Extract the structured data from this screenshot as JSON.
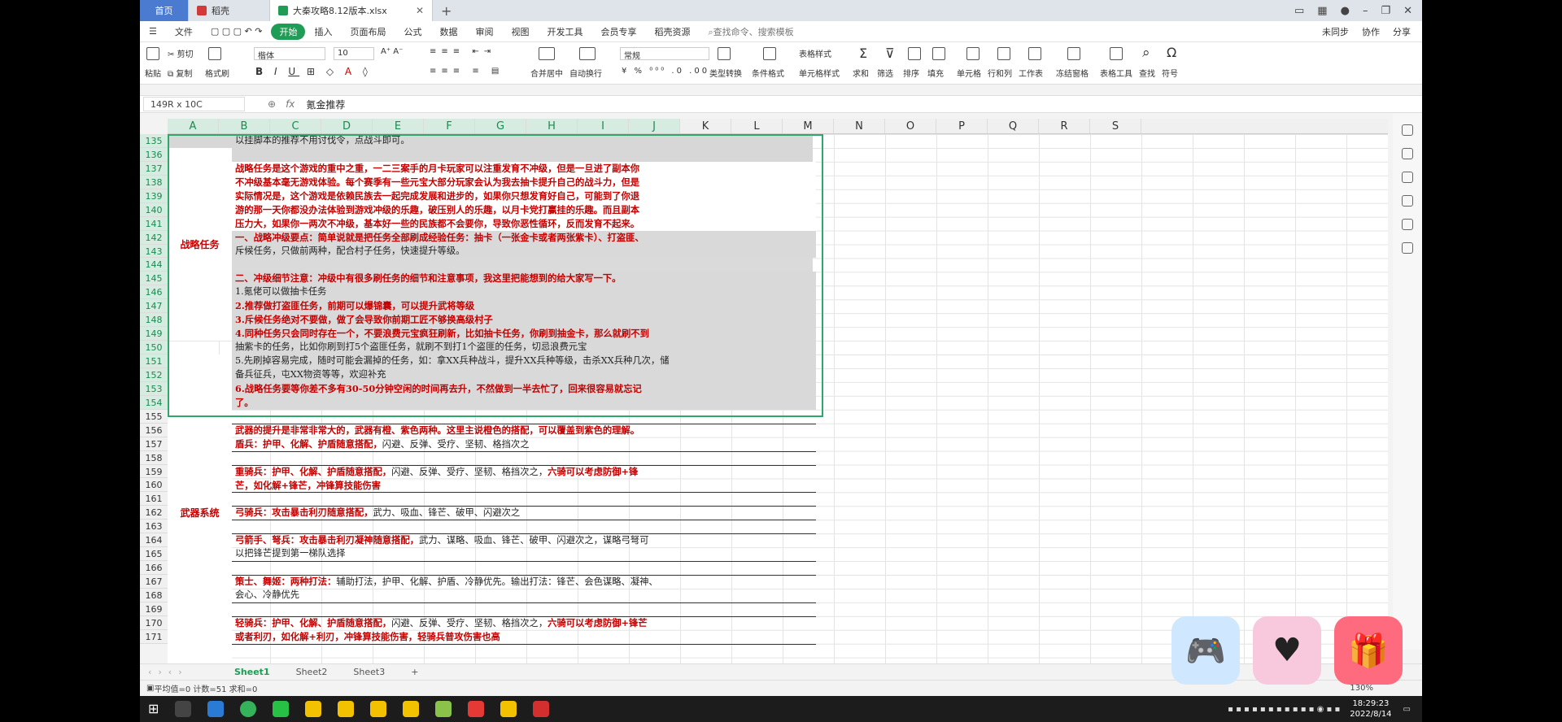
{
  "tabs": {
    "home": "首页",
    "doc1": "稻壳",
    "doc2": "大秦攻略8.12版本.xlsx"
  },
  "menu": {
    "items": [
      "文件",
      "开始",
      "插入",
      "页面布局",
      "公式",
      "数据",
      "审阅",
      "视图",
      "开发工具",
      "会员专享",
      "稻壳资源"
    ],
    "search": "查找命令、搜索模板",
    "right": [
      "未同步",
      "协作",
      "分享"
    ]
  },
  "ribbon": {
    "font_name": "楷体",
    "font_size": "10",
    "number_format": "常规",
    "labels": {
      "paste": "粘贴",
      "cut": "剪切",
      "copy": "复制",
      "painter": "格式刷",
      "merge": "合并居中",
      "wrap": "自动换行",
      "convert": "类型转换",
      "cond": "条件格式",
      "tablestyle": "表格样式",
      "cellstyle": "单元格样式",
      "sum": "求和",
      "filter": "筛选",
      "sort": "排序",
      "fill": "填充",
      "cell": "单元格",
      "rowcol": "行和列",
      "sheet": "工作表",
      "freeze": "冻结窗格",
      "tabletool": "表格工具",
      "find": "查找",
      "symbol": "符号"
    }
  },
  "formula_bar": {
    "namebox": "149R x 10C",
    "fx": "fx",
    "content": "氪金推荐"
  },
  "columns": [
    "A",
    "B",
    "C",
    "D",
    "E",
    "F",
    "G",
    "H",
    "I",
    "J",
    "K",
    "L",
    "M",
    "N",
    "O",
    "P",
    "Q",
    "R",
    "S"
  ],
  "rows": [
    "135",
    "136",
    "137",
    "138",
    "139",
    "140",
    "141",
    "142",
    "143",
    "144",
    "145",
    "146",
    "147",
    "148",
    "149",
    "150",
    "151",
    "152",
    "153",
    "154",
    "155",
    "156",
    "157",
    "158",
    "159",
    "160",
    "161",
    "162",
    "163",
    "164",
    "165",
    "166",
    "167",
    "168",
    "169",
    "170",
    "171"
  ],
  "merged": {
    "strategy": "战略任务",
    "weapon": "武器系统"
  },
  "cells": {
    "r135": "以挂脚本的推荐不用讨伐令，点战斗即可。",
    "r137": "战略任务是这个游戏的重中之重，一二三案手的月卡玩家可以注重发育不冲级，但是一旦进了副本你",
    "r138": "不冲级基本毫无游戏体验。每个赛季有一些元宝大部分玩家会认为我去抽卡提升自己的战斗力，但是",
    "r139": "实际情况是，这个游戏是依赖民族去一起完成发展和进步的，如果你只想发育好自己，可能到了你退",
    "r140": "游的那一天你都没办法体验到游戏冲级的乐趣，破压别人的乐趣，以月卡党打赢挂的乐趣。而且副本",
    "r141": "压力大，如果你一两次不冲级，基本好一些的民族都不会要你，导致你恶性循环，反而发育不起来。",
    "r142": "一、战略冲级要点：简单说就是把任务全部刷成经验任务：抽卡（一张金卡或者两张紫卡）、打盗匪、",
    "r143": "斥候任务，只做前两种，配合村子任务，快速提升等级。",
    "r145": "二、冲级细节注意：冲级中有很多刷任务的细节和注意事项，我这里把能想到的给大家写一下。",
    "r146": "1.氪佬可以做抽卡任务",
    "r147": "2.推荐做打盗匪任务，前期可以爆锦囊，可以提升武将等级",
    "r148": "3.斥候任务绝对不要做，做了会导致你前期工匠不够换高级村子",
    "r149": "4.同种任务只会同时存在一个，不要浪费元宝疯狂刷新，比如抽卡任务，你刷到抽金卡，那么就刷不到",
    "r150": "抽紫卡的任务，比如你刷到打5个盗匪任务，就刷不到打1个盗匪的任务，切忌浪费元宝",
    "r151": "5.先刷掉容易完成，随时可能会漏掉的任务，如：拿XX兵种战斗，提升XX兵种等级，击杀XX兵种几次，储",
    "r152": "备兵征兵，屯XX物资等等，欢迎补充",
    "r153": "6.战略任务要等你差不多有30-50分钟空闲的时间再去升，不然做到一半去忙了，回来很容易就忘记",
    "r154": "了。",
    "r156": "武器的提升是非常非常大的，武器有橙、紫色两种。这里主说橙色的搭配，可以覆盖到紫色的理解。",
    "r157a": "盾兵：护甲、化解、护盾随意搭配，",
    "r157b": "闪避、反弹、受疗、坚韧、格挡次之",
    "r159a": "重骑兵：护甲、化解、护盾随意搭配，",
    "r159b": "闪避、反弹、受疗、坚韧、格挡次之，",
    "r159c": "六骑可以考虑防御+锋",
    "r160": "芒，如化解+锋芒，冲锋算技能伤害",
    "r162a": "弓骑兵：攻击暴击利刃随意搭配，",
    "r162b": "武力、吸血、锋芒、破甲、闪避次之",
    "r164a": "弓箭手、弩兵：攻击暴击利刃凝神随意搭配，",
    "r164b": "武力、谋略、吸血、锋芒、破甲、闪避次之，谋略弓弩可",
    "r165": "以把锋芒提到第一梯队选择",
    "r167a": "策士、舞姬：两种打法：",
    "r167b": "辅助打法，护甲、化解、护盾、冷静优先。输出打法：锋芒、会色谋略、凝神、",
    "r168": "会心、冷静优先",
    "r170a": "轻骑兵：护甲、化解、护盾随意搭配，",
    "r170b": "闪避、反弹、受疗、坚韧、格挡次之，",
    "r170c": "六骑可以考虑防御+锋芒",
    "r171": "或者利刃，如化解+利刃，冲锋算技能伤害，轻骑兵普攻伤害也高"
  },
  "sheets": [
    "Sheet1",
    "Sheet2",
    "Sheet3"
  ],
  "status": {
    "summary": "平均值=0  计数=51  求和=0",
    "zoom": "130%"
  },
  "taskbar": {
    "time": "18:29:23",
    "date": "2022/8/14"
  }
}
